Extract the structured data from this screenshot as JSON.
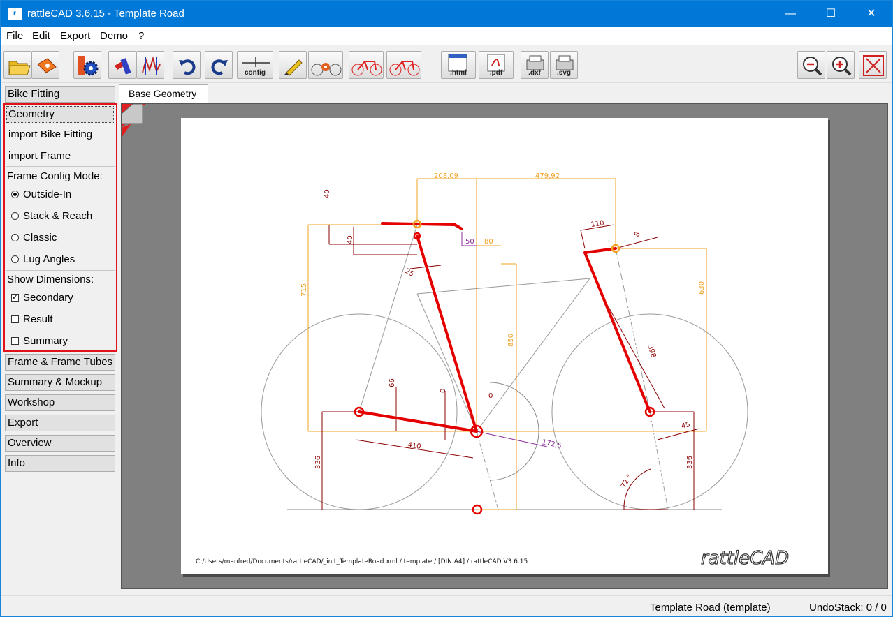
{
  "window": {
    "title": "rattleCAD  3.6.15 - Template Road",
    "app_icon": "rattle-icon"
  },
  "menu": [
    "File",
    "Edit",
    "Export",
    "Demo",
    "?"
  ],
  "toolbar": {
    "config_label": "config",
    "html_label": ".html",
    "pdf_label": ".pdf",
    "dxf_label": ".dxf",
    "svg_label": ".svg"
  },
  "sidebar": {
    "bike_fitting": "Bike Fitting",
    "geometry": "Geometry",
    "import_bike_fitting": "import Bike Fitting",
    "import_frame": "import Frame",
    "frame_config_mode": "Frame Config Mode:",
    "modes": [
      "Outside-In",
      "Stack & Reach",
      "Classic",
      "Lug Angles"
    ],
    "selected_mode": "Outside-In",
    "show_dimensions": "Show Dimensions:",
    "dimensions": [
      {
        "label": "Secondary",
        "checked": true
      },
      {
        "label": "Result",
        "checked": false
      },
      {
        "label": "Summary",
        "checked": false
      }
    ],
    "sections": [
      "Frame & Frame Tubes",
      "Summary & Mockup",
      "Workshop",
      "Export",
      "Overview",
      "Info"
    ]
  },
  "tab": {
    "label": "Base Geometry"
  },
  "drawing": {
    "dims": {
      "d208": "208,09",
      "d479": "479,92",
      "d40a": "40",
      "d40b": "40",
      "d50": "50",
      "d80": "80",
      "d110": "110",
      "d8": "8",
      "d25": "25",
      "d715": "715",
      "d850": "850",
      "d630": "630",
      "d398": "398",
      "d66": "66",
      "d0a": "0",
      "d0b": "0",
      "d410": "410",
      "d172": "172,5",
      "d45": "45",
      "d336a": "336",
      "d336b": "336",
      "d72": "72 °"
    },
    "footer": "C:/Users/manfred/Documents/rattleCAD/_init_TemplateRoad.xml   /   template   / [DIN A4] /   rattleCAD   V3.6.15",
    "logo": "rattleCAD"
  },
  "status": {
    "document": "Template Road (template)",
    "undo": "UndoStack:  0 /  0"
  },
  "colors": {
    "accent": "#0078d7",
    "frame_red": "#e50000",
    "dim_orange": "#f0a020",
    "dim_dark": "#8b0000",
    "highlight": "#e0131a"
  }
}
